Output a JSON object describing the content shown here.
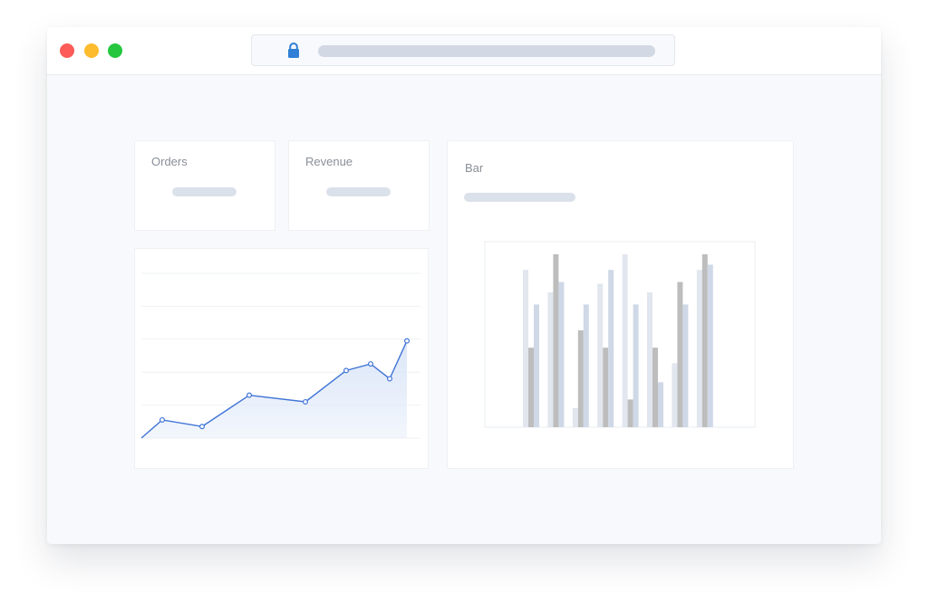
{
  "window": {
    "traffic_lights": [
      "close",
      "minimize",
      "maximize"
    ],
    "address_bar": {
      "icon": "lock-icon"
    }
  },
  "stats": {
    "orders_label": "Orders",
    "revenue_label": "Revenue"
  },
  "bar_panel": {
    "title": "Bar"
  },
  "colors": {
    "line": "#3f74d6",
    "area": "#dbe6f8",
    "bar_light": "#e2e6ee",
    "bar_dark": "#bdbdbd",
    "bar_blue": "#cfd8e6",
    "lock": "#2f7fd6"
  },
  "chart_data": [
    {
      "type": "area",
      "title": "",
      "xlabel": "",
      "ylabel": "",
      "grid": true,
      "x": [
        0,
        1,
        2,
        3,
        4,
        5,
        6,
        7,
        8,
        9
      ],
      "values": [
        0,
        11,
        7,
        26,
        22,
        41,
        45,
        36,
        59,
        null
      ],
      "points": [
        1,
        2,
        3,
        4,
        5,
        6,
        7,
        8
      ],
      "ylim": [
        0,
        100
      ]
    },
    {
      "type": "bar",
      "title": "Bar",
      "xlabel": "",
      "ylabel": "",
      "ylim": [
        0,
        100
      ],
      "categories": [
        "1",
        "2",
        "3",
        "4",
        "5",
        "6",
        "7",
        "8"
      ],
      "series": [
        {
          "values": [
            91,
            78,
            11,
            83,
            100,
            78,
            37,
            91
          ]
        },
        {
          "values": [
            46,
            100,
            56,
            46,
            16,
            46,
            84,
            100
          ]
        },
        {
          "values": [
            71,
            84,
            71,
            91,
            71,
            26,
            71,
            94
          ]
        }
      ]
    }
  ]
}
